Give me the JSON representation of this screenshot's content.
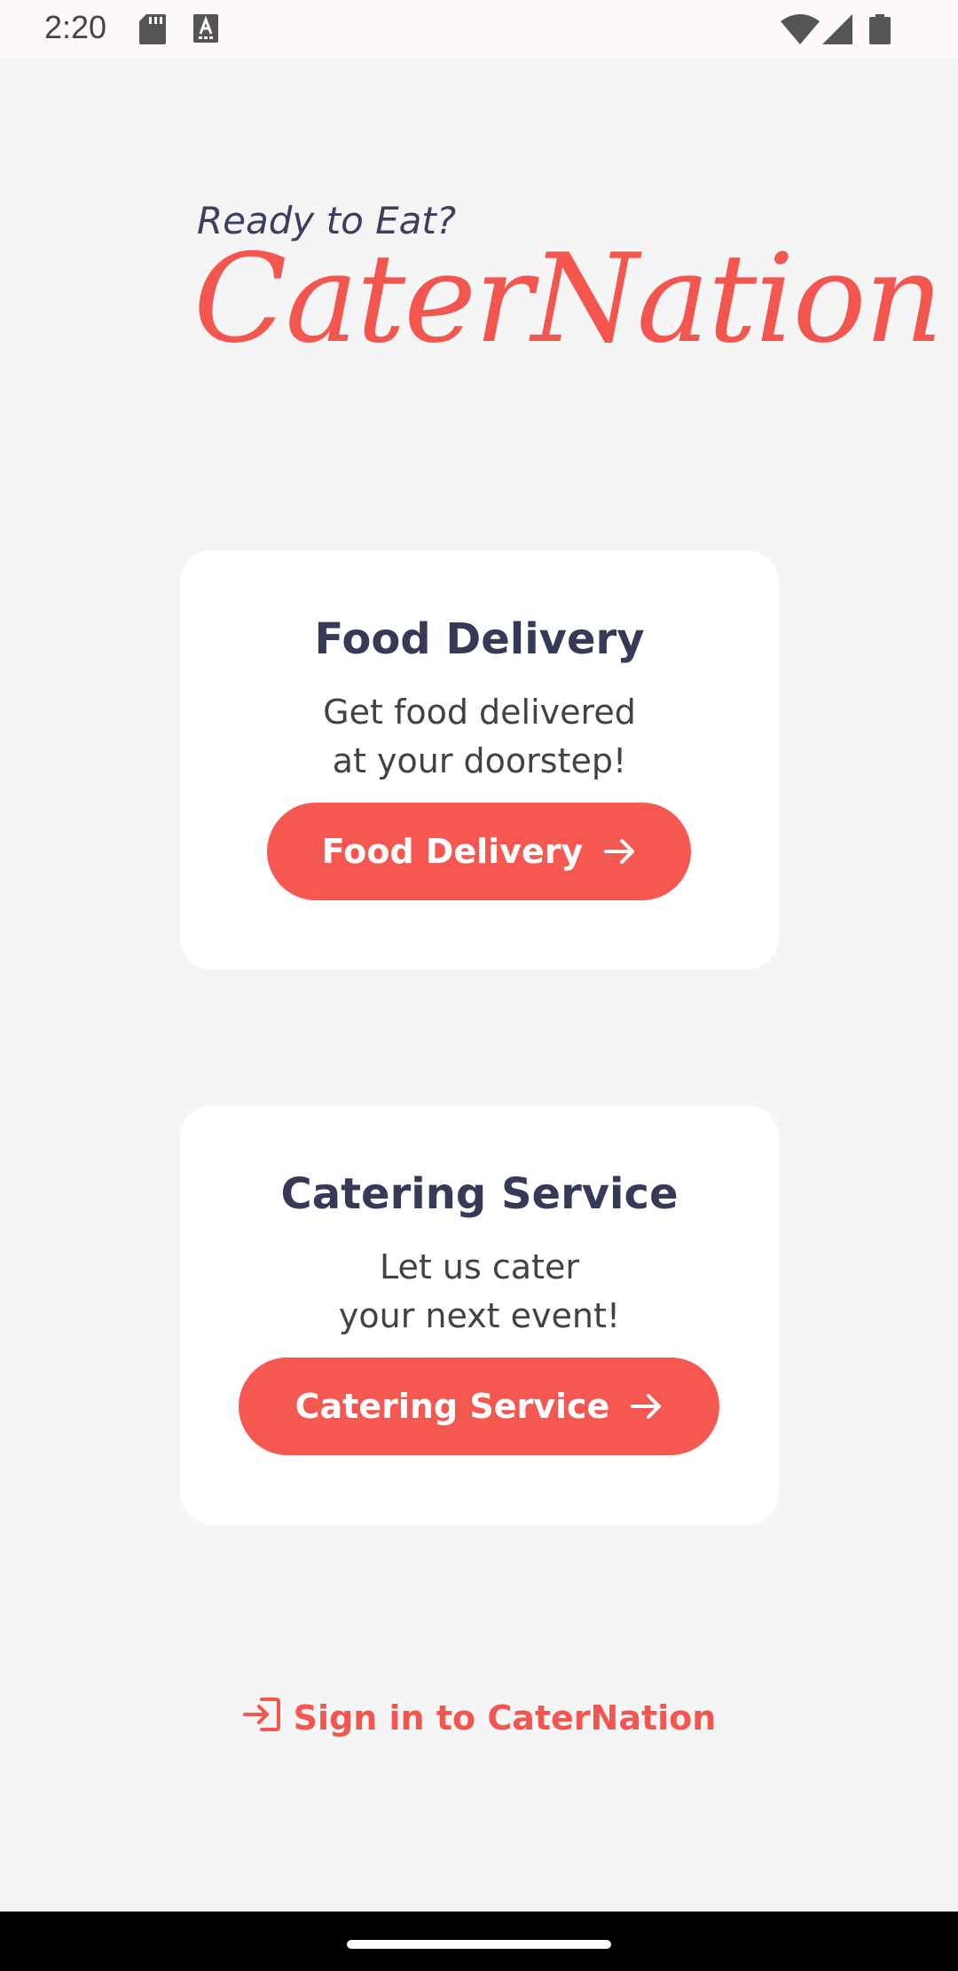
{
  "status_bar": {
    "time": "2:20",
    "left_icons": [
      "sd-card-icon",
      "keyboard-a-icon"
    ],
    "right_icons": [
      "wifi-icon",
      "signal-icon",
      "battery-icon"
    ]
  },
  "header": {
    "tagline": "Ready to Eat?",
    "brand": "CaterNation"
  },
  "cards": {
    "food": {
      "title": "Food Delivery",
      "desc_line1": "Get food delivered",
      "desc_line2": "at your doorstep!",
      "button_label": "Food Delivery"
    },
    "catering": {
      "title": "Catering Service",
      "desc_line1": "Let us cater",
      "desc_line2": "your next event!",
      "button_label": "Catering Service"
    }
  },
  "signin": {
    "label": "Sign in to CaterNation",
    "icon": "login-icon"
  },
  "colors": {
    "accent": "#f45851",
    "title": "#363a57",
    "background": "#f5f5f5",
    "card": "#ffffff"
  }
}
